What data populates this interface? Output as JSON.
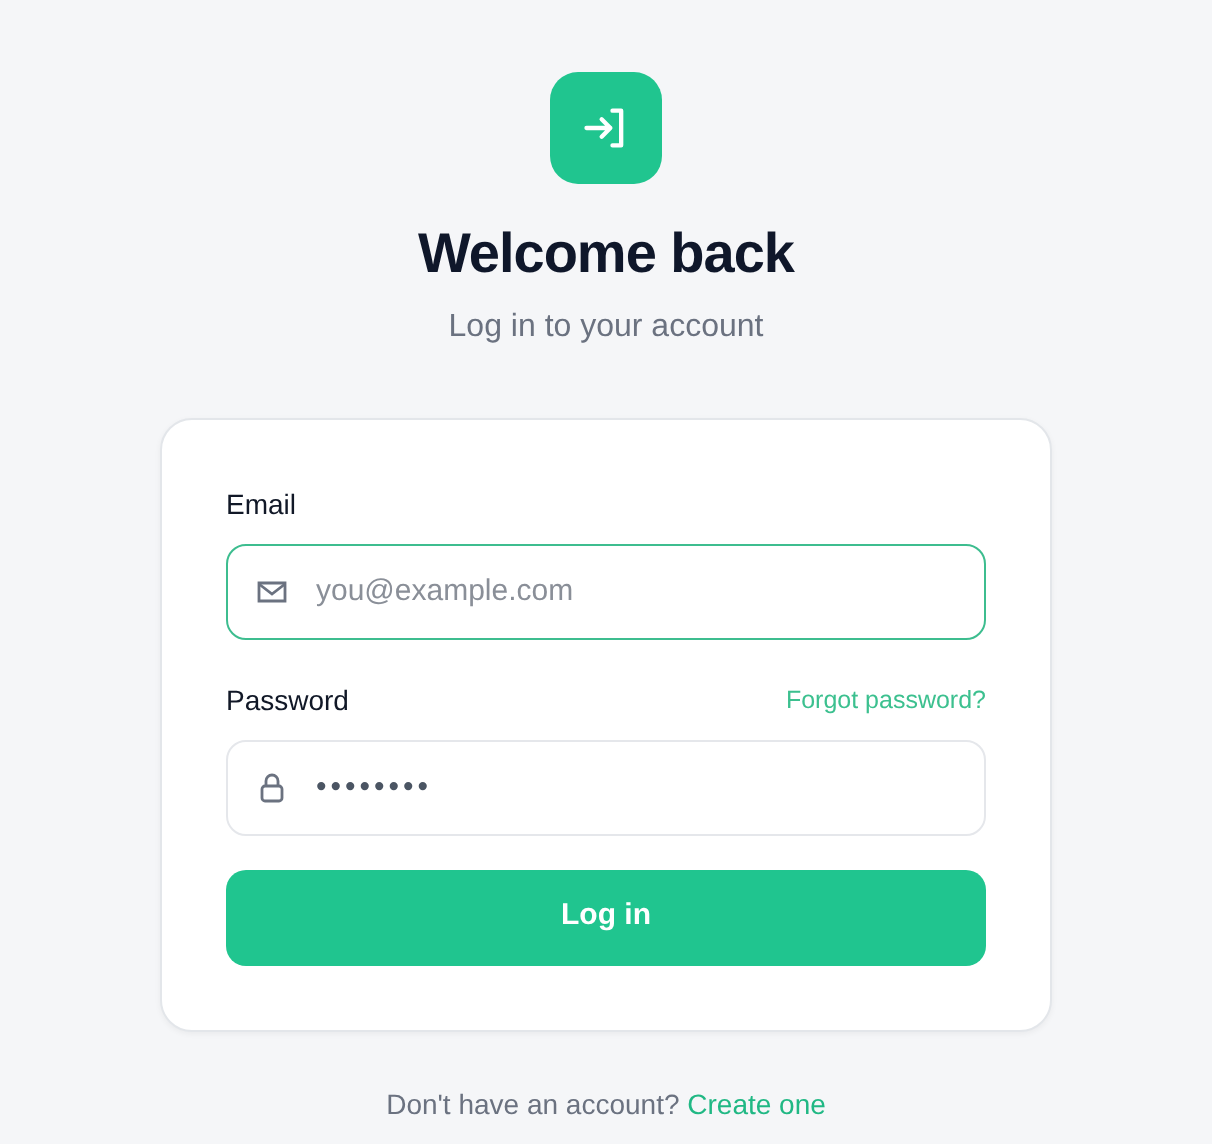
{
  "header": {
    "title": "Welcome back",
    "subtitle": "Log in to your account"
  },
  "fields": [
    {
      "label": "Email",
      "placeholder": "you@example.com",
      "focused": true,
      "kind": "email"
    },
    {
      "label": "Password",
      "value": "••••••••",
      "focused": false,
      "kind": "password",
      "link": "Forgot password?"
    }
  ],
  "submit": "Log in",
  "footer": {
    "text": "Don't have an account?",
    "link": "Create one"
  }
}
